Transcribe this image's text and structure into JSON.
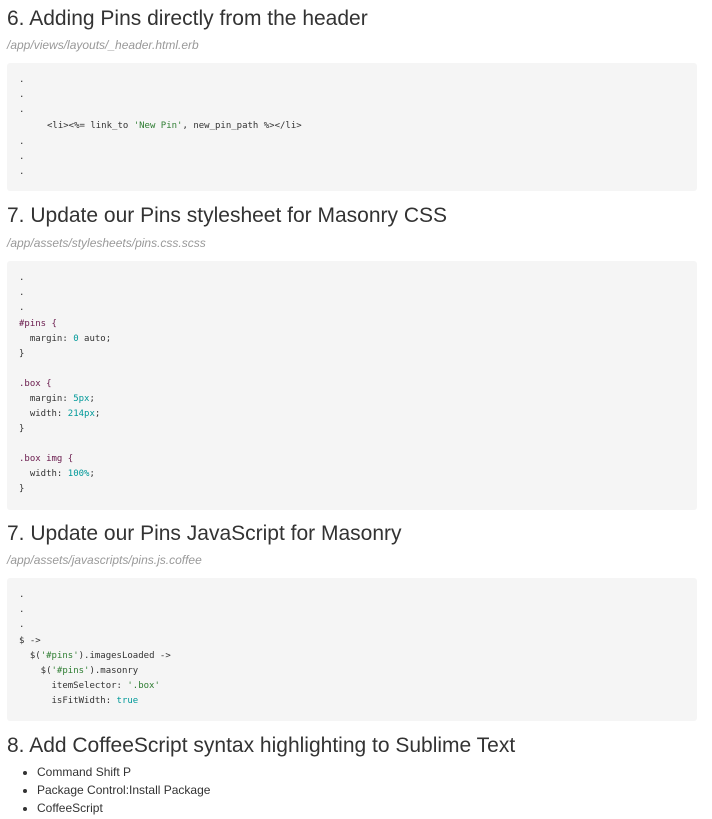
{
  "sections": [
    {
      "heading": "6. Adding Pins directly from the header",
      "path": "/app/views/layouts/_header.html.erb",
      "code": {
        "dots_top": [
          ".",
          ".",
          "."
        ],
        "line_open": "<li><%= link_to ",
        "line_str": "'New Pin'",
        "line_close": ", new_pin_path %></li>",
        "dots_bottom": [
          ".",
          ".",
          "."
        ]
      }
    },
    {
      "heading": "7. Update our Pins stylesheet for Masonry CSS",
      "path": "/app/assets/stylesheets/pins.css.scss",
      "code": {
        "dots": [
          ".",
          ".",
          "."
        ],
        "pins_sel": "#pins {",
        "pins_margin_prop": "  margin: ",
        "pins_margin_val": "0",
        "pins_margin_rest": " auto;",
        "close1": "}",
        "box_sel": ".box {",
        "box_margin_prop": "  margin: ",
        "box_margin_val": "5px",
        "box_margin_end": ";",
        "box_width_prop": "  width: ",
        "box_width_val": "214px",
        "box_width_end": ";",
        "close2": "}",
        "img_sel": ".box img {",
        "img_width_prop": "  width: ",
        "img_width_val": "100%",
        "img_width_end": ";",
        "close3": "}"
      }
    },
    {
      "heading": "7. Update our Pins JavaScript for Masonry",
      "path": "/app/assets/javascripts/pins.js.coffee",
      "code": {
        "dots": [
          ".",
          ".",
          "."
        ],
        "l1": "$ ->",
        "l2_a": "  $(",
        "l2_str": "'#pins'",
        "l2_b": ").imagesLoaded ->",
        "l3_a": "    $(",
        "l3_str": "'#pins'",
        "l3_b": ").masonry",
        "l4_a": "      itemSelector: ",
        "l4_str": "'.box'",
        "l5_a": "      isFitWidth: ",
        "l5_val": "true"
      }
    },
    {
      "heading": "8. Add CoffeeScript syntax highlighting to Sublime Text",
      "items": [
        "Command Shift P",
        "Package Control:Install Package",
        "CoffeeScript"
      ]
    }
  ],
  "colors": {
    "code_bg": "#f5f5f5",
    "string": "#2e7d32",
    "number": "#009999",
    "selector": "#6a1b4d",
    "path": "#999999"
  }
}
